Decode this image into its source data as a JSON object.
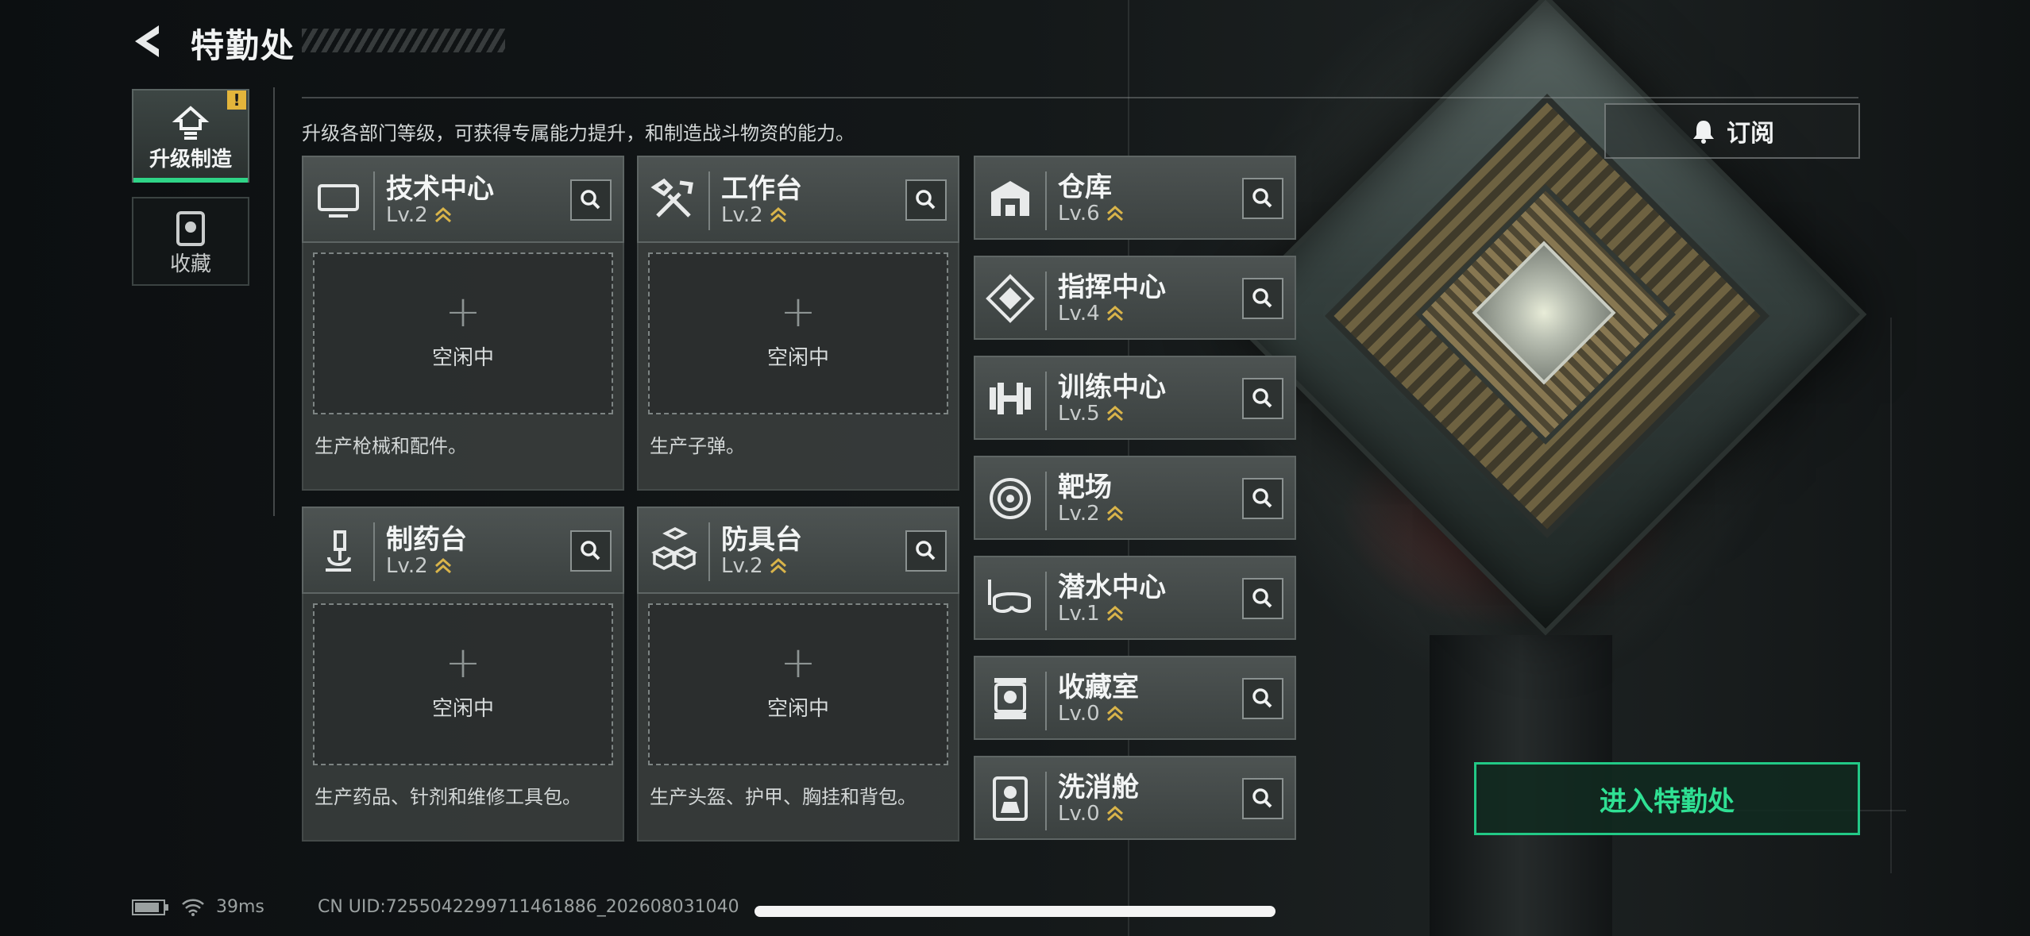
{
  "header": {
    "title": "特勤处"
  },
  "side_tabs": [
    {
      "label": "升级制造",
      "active": true,
      "badge": "!"
    },
    {
      "label": "收藏",
      "active": false
    }
  ],
  "description": "升级各部门等级，可获得专属能力提升，和制造战斗物资的能力。",
  "subscribe_label": "订阅",
  "idle_plus": "+",
  "departments": [
    {
      "name": "技术中心",
      "level": "Lv.2",
      "idle": "空闲中",
      "produces": "生产枪械和配件。",
      "icon": "monitor-icon"
    },
    {
      "name": "工作台",
      "level": "Lv.2",
      "idle": "空闲中",
      "produces": "生产子弹。",
      "icon": "tools-icon"
    },
    {
      "name": "制药台",
      "level": "Lv.2",
      "idle": "空闲中",
      "produces": "生产药品、针剂和维修工具包。",
      "icon": "microscope-icon"
    },
    {
      "name": "防具台",
      "level": "Lv.2",
      "idle": "空闲中",
      "produces": "生产头盔、护甲、胸挂和背包。",
      "icon": "armor-blocks-icon"
    }
  ],
  "facilities": [
    {
      "name": "仓库",
      "level": "Lv.6",
      "icon": "warehouse-icon"
    },
    {
      "name": "指挥中心",
      "level": "Lv.4",
      "icon": "command-diamond-icon"
    },
    {
      "name": "训练中心",
      "level": "Lv.5",
      "icon": "dumbbell-icon"
    },
    {
      "name": "靶场",
      "level": "Lv.2",
      "icon": "target-icon"
    },
    {
      "name": "潜水中心",
      "level": "Lv.1",
      "icon": "diving-mask-icon"
    },
    {
      "name": "收藏室",
      "level": "Lv.0",
      "icon": "display-case-icon"
    },
    {
      "name": "洗消舱",
      "level": "Lv.0",
      "icon": "decon-suit-icon"
    }
  ],
  "enter_button": "进入特勤处",
  "status": {
    "ping": "39ms",
    "uid": "CN UID:7255042299711461886_202608031040"
  },
  "colors": {
    "accent_green": "#2fe093",
    "level_chevron": "#d9b44a",
    "warning": "#e3b53b"
  }
}
